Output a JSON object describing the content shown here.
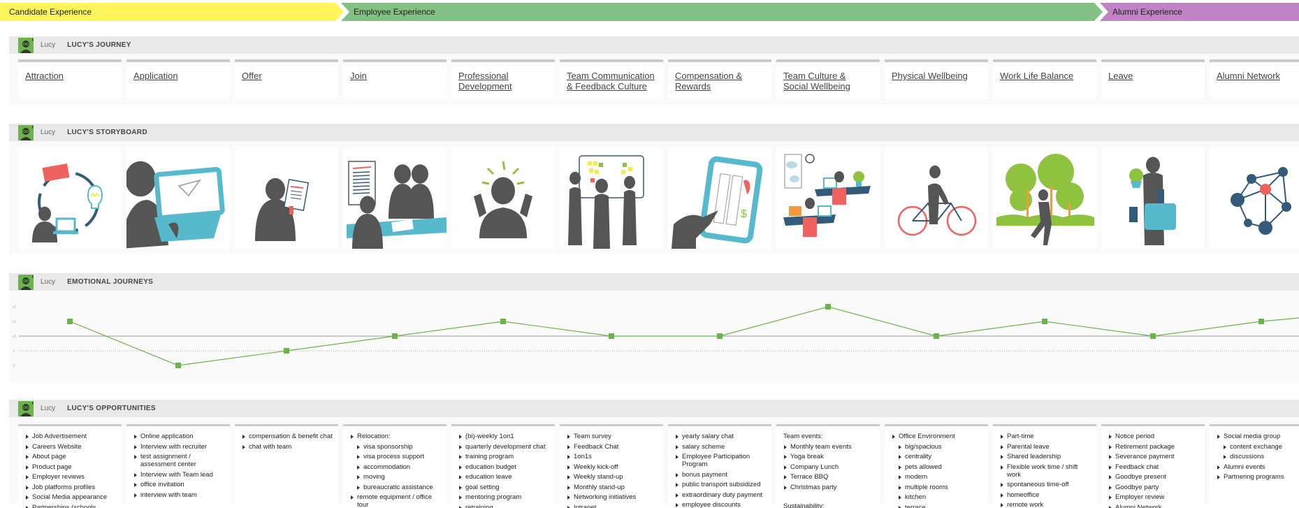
{
  "phases": [
    {
      "label": "Candidate Experience",
      "color": "#fef45b"
    },
    {
      "label": "Employee Experience",
      "color": "#83c083"
    },
    {
      "label": "Alumni Experience",
      "color": "#bf83c6"
    }
  ],
  "persona": {
    "name": "Lucy",
    "avatar_color": "#6bb34b"
  },
  "journey": {
    "title": "LUCY'S JOURNEY",
    "stages": [
      "Attraction",
      "Application",
      "Offer",
      "Join",
      "Professional Development",
      "Team Communication & Feedback Culture",
      "Compensation & Rewards",
      "Team Culture & Social Wellbeing",
      "Physical Wellbeing",
      "Work Life Balance",
      "Leave",
      "Alumni Network"
    ]
  },
  "storyboard": {
    "title": "LUCY'S STORYBOARD",
    "scenes": [
      "person-laptop-research-cycle",
      "person-laptop-send",
      "person-reading-contract",
      "team-meeting-table",
      "person-cheering",
      "team-sticky-notes-board",
      "hand-tablet-salary",
      "office-desks-coworkers",
      "person-cycling",
      "person-running-park",
      "person-leaving-with-bags",
      "network-graph"
    ]
  },
  "emotions": {
    "title": "EMOTIONAL JOURNEYS",
    "chart_data": {
      "type": "line",
      "categories": [
        "Attraction",
        "Application",
        "Offer",
        "Join",
        "Professional Development",
        "Team Communication & Feedback Culture",
        "Compensation & Rewards",
        "Team Culture & Social Wellbeing",
        "Physical Wellbeing",
        "Work Life Balance",
        "Leave",
        "Alumni Network"
      ],
      "values": [
        1,
        -2,
        -1,
        0,
        1,
        0,
        0,
        2,
        0,
        1,
        0,
        1
      ],
      "ytick_labels": [
        "+2",
        "+1",
        "+0",
        "-1",
        "-2"
      ],
      "yticks": [
        2,
        1,
        0,
        -1,
        -2
      ],
      "ylim": [
        -2,
        2
      ],
      "baseline": 0,
      "dotted_reference": -1,
      "series_color": "#6bb34b"
    }
  },
  "opportunities": {
    "title": "LUCY'S OPPORTUNITIES",
    "columns": [
      [
        {
          "t": "Job Advertisement"
        },
        {
          "t": "Careers Website"
        },
        {
          "t": "About page"
        },
        {
          "t": "Product page"
        },
        {
          "t": "Employer reviews"
        },
        {
          "t": "Job platforms profiles"
        },
        {
          "t": "Social Media appearance"
        },
        {
          "t": "Partnerships (schools"
        }
      ],
      [
        {
          "t": "Online application"
        },
        {
          "t": "Interview with recruiter"
        },
        {
          "t": "test assignment / assessment center"
        },
        {
          "t": "Interview with Team lead"
        },
        {
          "t": "office invitation"
        },
        {
          "t": "interview with team"
        }
      ],
      [
        {
          "t": "compensation & benefit chat"
        },
        {
          "t": "chat with team"
        }
      ],
      [
        {
          "t": "Relocation:"
        },
        {
          "t": "visa sponsorship",
          "sub": true
        },
        {
          "t": "visa process support",
          "sub": true
        },
        {
          "t": "accommodation",
          "sub": true
        },
        {
          "t": "moving",
          "sub": true
        },
        {
          "t": "bureaucratic assistance",
          "sub": true
        },
        {
          "t": "remote equipment / office tour"
        }
      ],
      [
        {
          "t": "(bi)-weekly 1on1"
        },
        {
          "t": "quarterly development chat"
        },
        {
          "t": "training program"
        },
        {
          "t": "education budget"
        },
        {
          "t": "education leave"
        },
        {
          "t": "goal setting"
        },
        {
          "t": "mentoring program"
        },
        {
          "t": "retraining"
        }
      ],
      [
        {
          "t": "Team survey"
        },
        {
          "t": "Feedback Chat"
        },
        {
          "t": "1on1s"
        },
        {
          "t": "Weekly kick-off"
        },
        {
          "t": "Weekly stand-up"
        },
        {
          "t": "Monthly stand-up"
        },
        {
          "t": "Networking initiatives"
        },
        {
          "t": "Intranet"
        }
      ],
      [
        {
          "t": "yearly salary chat"
        },
        {
          "t": "salary scheme"
        },
        {
          "t": "Employee Participation Program"
        },
        {
          "t": "bonus payment"
        },
        {
          "t": "public transport subsidized"
        },
        {
          "t": "extraordinary duty payment"
        },
        {
          "t": "employee discounts"
        }
      ],
      [
        {
          "t": "Team events:",
          "plain": true
        },
        {
          "t": "Monthly team events"
        },
        {
          "t": "Yoga break"
        },
        {
          "t": "Company Lunch"
        },
        {
          "t": "Terrace BBQ"
        },
        {
          "t": "Christmas party"
        },
        {
          "t": "Sustainability:",
          "plain": true,
          "gap": true
        }
      ],
      [
        {
          "t": "Office Environment"
        },
        {
          "t": "big/spacious",
          "sub": true
        },
        {
          "t": "centrality",
          "sub": true
        },
        {
          "t": "pets allowed",
          "sub": true
        },
        {
          "t": "modern",
          "sub": true
        },
        {
          "t": "multiple rooms",
          "sub": true
        },
        {
          "t": "kitchen",
          "sub": true
        },
        {
          "t": "terrace",
          "sub": true
        }
      ],
      [
        {
          "t": "Part-time"
        },
        {
          "t": "Parental leave"
        },
        {
          "t": "Shared leadership"
        },
        {
          "t": "Flexible work time / shift work"
        },
        {
          "t": "spontaneous time-off"
        },
        {
          "t": "homeoffice"
        },
        {
          "t": "remote work"
        }
      ],
      [
        {
          "t": "Notice period"
        },
        {
          "t": "Retirement package"
        },
        {
          "t": "Severance payment"
        },
        {
          "t": "Feedback chat"
        },
        {
          "t": "Goodbye present"
        },
        {
          "t": "Goodbye party"
        },
        {
          "t": "Employer review"
        },
        {
          "t": "Alumni Network"
        }
      ],
      [
        {
          "t": "Social media group"
        },
        {
          "t": "content exchange",
          "sub": true
        },
        {
          "t": "discussions",
          "sub": true
        },
        {
          "t": "Alumni events"
        },
        {
          "t": "Partnering programs"
        }
      ]
    ]
  }
}
